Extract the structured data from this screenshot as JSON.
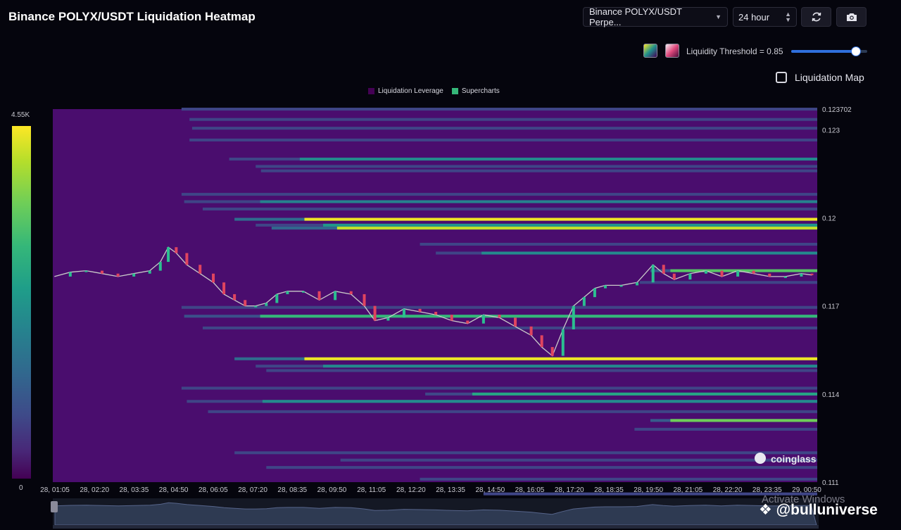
{
  "header": {
    "title": "Binance POLYX/USDT Liquidation Heatmap",
    "pair_select": "Binance POLYX/USDT Perpe...",
    "range_select": "24 hour",
    "refresh_icon": "refresh-icon",
    "camera_icon": "camera-icon"
  },
  "controls": {
    "threshold_label": "Liquidity Threshold = 0.85",
    "threshold_value": 0.85,
    "liquidation_map_label": "Liquidation Map",
    "liquidation_map_checked": false
  },
  "legend": [
    {
      "label": "Liquidation Leverage",
      "color": "#440154"
    },
    {
      "label": "Supercharts",
      "color": "#35b779"
    }
  ],
  "colorbar": {
    "max_label": "4.55K",
    "min_label": "0"
  },
  "watermark": {
    "brand": "coinglass",
    "overlay_text": "Activate Windows",
    "handle": "@bulluniverse"
  },
  "chart_data": {
    "type": "heatmap",
    "title": "Binance POLYX/USDT Liquidation Heatmap",
    "x_ticks": [
      "28, 01:05",
      "28, 02:20",
      "28, 03:35",
      "28, 04:50",
      "28, 06:05",
      "28, 07:20",
      "28, 08:35",
      "28, 09:50",
      "28, 11:05",
      "28, 12:20",
      "28, 13:35",
      "28, 14:50",
      "28, 16:05",
      "28, 17:20",
      "28, 18:35",
      "28, 19:50",
      "28, 21:05",
      "28, 22:20",
      "28, 23:35",
      "29, 00:50"
    ],
    "y_ticks": [
      "0.123702",
      "0.123",
      "0.12",
      "0.117",
      "0.114",
      "0.111"
    ],
    "y_tick_values": [
      0.123702,
      0.123,
      0.12,
      0.117,
      0.114,
      0.111
    ],
    "ylim": [
      0.111,
      0.123702
    ],
    "x_range_minutes": [
      -3,
      1440
    ],
    "colorbar_range": [
      0,
      4550
    ],
    "liquidation_levels": [
      {
        "price": 0.1237,
        "start_min": 240,
        "intensity": 0.28
      },
      {
        "price": 0.12335,
        "start_min": 255,
        "intensity": 0.32
      },
      {
        "price": 0.12305,
        "start_min": 260,
        "intensity": 0.35
      },
      {
        "price": 0.12265,
        "start_min": 255,
        "intensity": 0.3
      },
      {
        "price": 0.122,
        "start_min": 330,
        "intensity": 0.55
      },
      {
        "price": 0.12175,
        "start_min": 380,
        "intensity": 0.5
      },
      {
        "price": 0.1216,
        "start_min": 390,
        "intensity": 0.45
      },
      {
        "price": 0.1208,
        "start_min": 240,
        "intensity": 0.4
      },
      {
        "price": 0.12055,
        "start_min": 245,
        "intensity": 0.52
      },
      {
        "price": 0.1203,
        "start_min": 280,
        "intensity": 0.48
      },
      {
        "price": 0.11995,
        "start_min": 340,
        "intensity": 0.98
      },
      {
        "price": 0.11975,
        "start_min": 380,
        "intensity": 0.6
      },
      {
        "price": 0.11965,
        "start_min": 410,
        "intensity": 0.92
      },
      {
        "price": 0.1191,
        "start_min": 690,
        "intensity": 0.45
      },
      {
        "price": 0.1188,
        "start_min": 720,
        "intensity": 0.55
      },
      {
        "price": 0.1182,
        "start_min": 1125,
        "intensity": 0.78
      },
      {
        "price": 0.1178,
        "start_min": 1105,
        "intensity": 0.42
      },
      {
        "price": 0.11695,
        "start_min": 240,
        "intensity": 0.4
      },
      {
        "price": 0.11665,
        "start_min": 245,
        "intensity": 0.72
      },
      {
        "price": 0.11625,
        "start_min": 280,
        "intensity": 0.45
      },
      {
        "price": 0.1152,
        "start_min": 340,
        "intensity": 0.98
      },
      {
        "price": 0.11495,
        "start_min": 380,
        "intensity": 0.55
      },
      {
        "price": 0.1148,
        "start_min": 400,
        "intensity": 0.5
      },
      {
        "price": 0.1142,
        "start_min": 240,
        "intensity": 0.35
      },
      {
        "price": 0.114,
        "start_min": 700,
        "intensity": 0.65
      },
      {
        "price": 0.11375,
        "start_min": 250,
        "intensity": 0.55
      },
      {
        "price": 0.1134,
        "start_min": 290,
        "intensity": 0.4
      },
      {
        "price": 0.1131,
        "start_min": 1125,
        "intensity": 0.82
      },
      {
        "price": 0.1128,
        "start_min": 1095,
        "intensity": 0.45
      },
      {
        "price": 0.112,
        "start_min": 340,
        "intensity": 0.48
      },
      {
        "price": 0.11175,
        "start_min": 540,
        "intensity": 0.45
      },
      {
        "price": 0.1115,
        "start_min": 400,
        "intensity": 0.4
      },
      {
        "price": 0.1111,
        "start_min": 690,
        "intensity": 0.35
      },
      {
        "price": 0.1106,
        "start_min": 810,
        "intensity": 0.32
      }
    ],
    "price_series": [
      {
        "t": 0,
        "p": 0.118
      },
      {
        "t": 30,
        "p": 0.11815
      },
      {
        "t": 60,
        "p": 0.1182
      },
      {
        "t": 90,
        "p": 0.1181
      },
      {
        "t": 120,
        "p": 0.118
      },
      {
        "t": 150,
        "p": 0.1181
      },
      {
        "t": 180,
        "p": 0.1182
      },
      {
        "t": 200,
        "p": 0.1185
      },
      {
        "t": 215,
        "p": 0.119
      },
      {
        "t": 230,
        "p": 0.1188
      },
      {
        "t": 250,
        "p": 0.1184
      },
      {
        "t": 275,
        "p": 0.1181
      },
      {
        "t": 300,
        "p": 0.1178
      },
      {
        "t": 320,
        "p": 0.1174
      },
      {
        "t": 340,
        "p": 0.1172
      },
      {
        "t": 360,
        "p": 0.117
      },
      {
        "t": 380,
        "p": 0.117
      },
      {
        "t": 400,
        "p": 0.1171
      },
      {
        "t": 420,
        "p": 0.1174
      },
      {
        "t": 440,
        "p": 0.1175
      },
      {
        "t": 470,
        "p": 0.1175
      },
      {
        "t": 500,
        "p": 0.1172
      },
      {
        "t": 530,
        "p": 0.1175
      },
      {
        "t": 560,
        "p": 0.1174
      },
      {
        "t": 585,
        "p": 0.117
      },
      {
        "t": 605,
        "p": 0.1165
      },
      {
        "t": 630,
        "p": 0.1166
      },
      {
        "t": 660,
        "p": 0.1169
      },
      {
        "t": 690,
        "p": 0.1168
      },
      {
        "t": 720,
        "p": 0.1167
      },
      {
        "t": 750,
        "p": 0.1165
      },
      {
        "t": 780,
        "p": 0.1164
      },
      {
        "t": 810,
        "p": 0.1167
      },
      {
        "t": 840,
        "p": 0.1166
      },
      {
        "t": 870,
        "p": 0.1163
      },
      {
        "t": 900,
        "p": 0.116
      },
      {
        "t": 920,
        "p": 0.1156
      },
      {
        "t": 940,
        "p": 0.1153
      },
      {
        "t": 960,
        "p": 0.1162
      },
      {
        "t": 980,
        "p": 0.117
      },
      {
        "t": 1000,
        "p": 0.1173
      },
      {
        "t": 1020,
        "p": 0.1176
      },
      {
        "t": 1040,
        "p": 0.1177
      },
      {
        "t": 1070,
        "p": 0.1177
      },
      {
        "t": 1100,
        "p": 0.1178
      },
      {
        "t": 1130,
        "p": 0.1184
      },
      {
        "t": 1150,
        "p": 0.1181
      },
      {
        "t": 1170,
        "p": 0.1179
      },
      {
        "t": 1200,
        "p": 0.1181
      },
      {
        "t": 1230,
        "p": 0.1182
      },
      {
        "t": 1260,
        "p": 0.118
      },
      {
        "t": 1290,
        "p": 0.1182
      },
      {
        "t": 1320,
        "p": 0.1181
      },
      {
        "t": 1350,
        "p": 0.118
      },
      {
        "t": 1380,
        "p": 0.118
      },
      {
        "t": 1410,
        "p": 0.1181
      },
      {
        "t": 1430,
        "p": 0.11805
      }
    ]
  }
}
